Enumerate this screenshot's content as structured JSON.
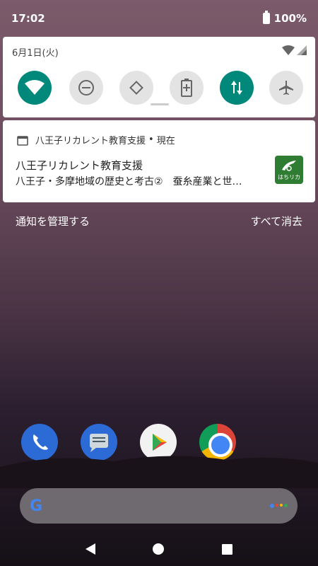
{
  "status_bar": {
    "time": "17:02",
    "battery": "100%"
  },
  "quick_settings": {
    "date": "6月1日(火)",
    "tiles": [
      {
        "name": "wifi",
        "state": "on"
      },
      {
        "name": "do-not-disturb",
        "state": "off"
      },
      {
        "name": "auto-rotate",
        "state": "off"
      },
      {
        "name": "battery-saver",
        "state": "off"
      },
      {
        "name": "mobile-data",
        "state": "on"
      },
      {
        "name": "airplane-mode",
        "state": "off"
      }
    ]
  },
  "notification": {
    "app_name": "八王子リカレント教育支援",
    "separator": "•",
    "time": "現在",
    "title": "八王子リカレント教育支援",
    "text": "八王子・多摩地域の歴史と考古②　蚕糸産業と世…",
    "logo_brand": "はちリカ"
  },
  "actions": {
    "manage": "通知を管理する",
    "clear_all": "すべて消去"
  },
  "dock": [
    "phone-icon",
    "messages-icon",
    "play-store-icon",
    "chrome-icon"
  ],
  "colors": {
    "accent": "#00897b",
    "tile_off": "#e3e3e3",
    "panel": "#ffffff"
  }
}
